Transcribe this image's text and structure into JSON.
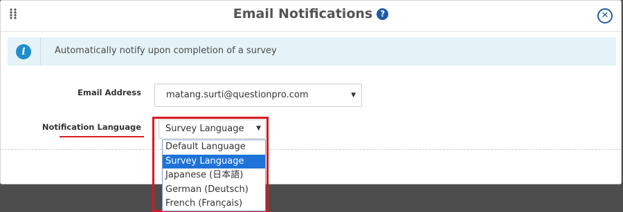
{
  "header": {
    "title": "Email Notifications",
    "help_glyph": "?",
    "close_glyph": "✕",
    "drag_icon": "grip-dots-icon"
  },
  "info": {
    "icon_glyph": "i",
    "text": "Automatically notify upon completion of a survey"
  },
  "form": {
    "email_label": "Email Address",
    "email_value": "matang.surti@questionpro.com",
    "language_label": "Notification Language",
    "language_value": "Survey Language",
    "language_options": [
      {
        "label": "Default Language",
        "selected": false
      },
      {
        "label": "Survey Language",
        "selected": true
      },
      {
        "label": "Japanese (日本語)",
        "selected": false
      },
      {
        "label": "German (Deutsch)",
        "selected": false
      },
      {
        "label": "French (Français)",
        "selected": false
      }
    ]
  },
  "colors": {
    "accent": "#1e5aa6",
    "info_bg": "#e5f3f8",
    "info_icon": "#1f8ecc",
    "highlight": "#d71920",
    "selected_option": "#1e73d8"
  }
}
